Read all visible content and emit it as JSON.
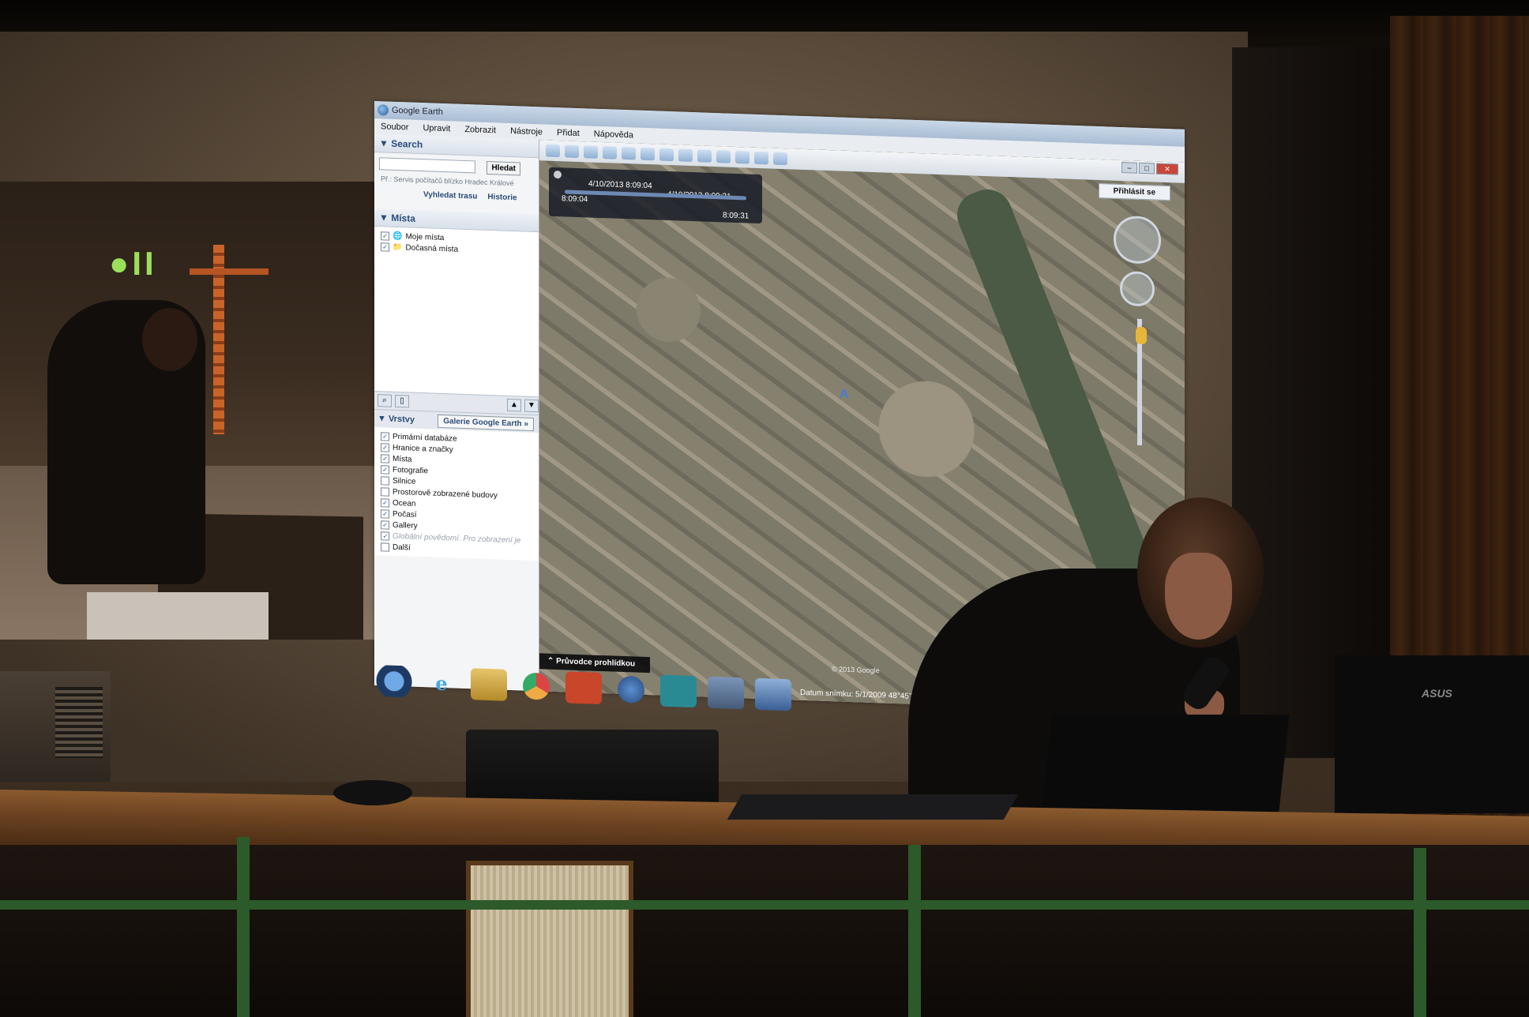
{
  "video": {
    "rec_indicator": "●II"
  },
  "window": {
    "title": "Google Earth"
  },
  "menu": [
    "Soubor",
    "Upravit",
    "Zobrazit",
    "Nástroje",
    "Přidat",
    "Nápověda"
  ],
  "search": {
    "header": "▼ Search",
    "button": "Hledat",
    "hint": "Př.: Servis počítačů blízko Hradec Králové",
    "links": [
      "Vyhledat trasu",
      "Historie"
    ]
  },
  "places": {
    "header": "▼ Místa",
    "items": [
      "Moje místa",
      "Dočasná místa"
    ]
  },
  "layers": {
    "header": "▼ Vrstvy",
    "gallery_button": "Galerie Google Earth »",
    "items": [
      {
        "label": "Primární databáze",
        "checked": true,
        "greyed": false
      },
      {
        "label": "Hranice a značky",
        "checked": true,
        "greyed": false
      },
      {
        "label": "Místa",
        "checked": true,
        "greyed": false
      },
      {
        "label": "Fotografie",
        "checked": true,
        "greyed": false
      },
      {
        "label": "Silnice",
        "checked": false,
        "greyed": false
      },
      {
        "label": "Prostorově zobrazené budovy",
        "checked": false,
        "greyed": false
      },
      {
        "label": "Ocean",
        "checked": true,
        "greyed": false
      },
      {
        "label": "Počasí",
        "checked": true,
        "greyed": false
      },
      {
        "label": "Gallery",
        "checked": true,
        "greyed": false
      },
      {
        "label": "Globální povědomí. Pro zobrazení je",
        "checked": true,
        "greyed": true
      },
      {
        "label": "Další",
        "checked": false,
        "greyed": false
      }
    ]
  },
  "tour_slider": {
    "start_time": "4/10/2013  8:09:04",
    "end_time": "4/10/2013  8:09:31",
    "left_time": "8:09:04",
    "right_time": "8:09:31"
  },
  "map": {
    "login_button": "Přihlásit se",
    "tour_guide": "⌃ Průvodce prohlídkou",
    "copyright": "© 2013 Google",
    "status": "Datum snímku: 5/1/2009     48°45'28.27\"",
    "marker": "A",
    "window_buttons": [
      "–",
      "□",
      "✕"
    ]
  },
  "laptop": {
    "brand": "ASUS"
  },
  "colors": {
    "accent": "#2a4c7a",
    "rec_green": "#9be05a",
    "close_red": "#c8473a"
  }
}
